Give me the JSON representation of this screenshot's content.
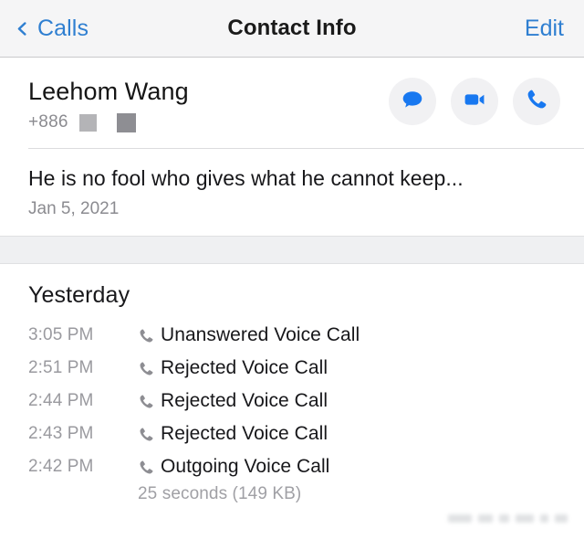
{
  "navbar": {
    "back_label": "Calls",
    "back_icon": "chevron-left-icon",
    "title": "Contact Info",
    "edit_label": "Edit",
    "accent_color": "#2f7fd1"
  },
  "contact": {
    "name": "Leehom Wang",
    "phone_prefix": "+886",
    "redacted_blocks": 2,
    "actions": [
      {
        "name": "message-button",
        "icon": "message-bubble-icon"
      },
      {
        "name": "video-call-button",
        "icon": "video-camera-icon"
      },
      {
        "name": "voice-call-button",
        "icon": "phone-handset-icon"
      }
    ],
    "action_icon_color": "#1878f0",
    "action_bg_color": "#f1f1f3"
  },
  "status": {
    "text": "He is no fool who gives what he cannot keep...",
    "date": "Jan 5, 2021"
  },
  "calls": {
    "heading": "Yesterday",
    "entries": [
      {
        "time": "3:05 PM",
        "label": "Unanswered Voice Call",
        "icon": "phone-handset-icon",
        "duration": ""
      },
      {
        "time": "2:51 PM",
        "label": "Rejected Voice Call",
        "icon": "phone-handset-icon",
        "duration": ""
      },
      {
        "time": "2:44 PM",
        "label": "Rejected Voice Call",
        "icon": "phone-handset-icon",
        "duration": ""
      },
      {
        "time": "2:43 PM",
        "label": "Rejected Voice Call",
        "icon": "phone-handset-icon",
        "duration": ""
      },
      {
        "time": "2:42 PM",
        "label": "Outgoing Voice Call",
        "icon": "phone-handset-icon",
        "duration": "25 seconds (149 KB)"
      }
    ]
  }
}
